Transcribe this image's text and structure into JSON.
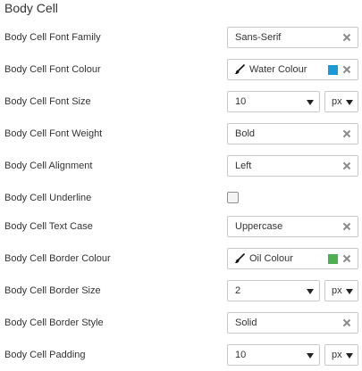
{
  "section": {
    "title": "Body Cell"
  },
  "rows": {
    "font_family": {
      "label": "Body Cell Font Family",
      "value": "Sans-Serif"
    },
    "font_colour": {
      "label": "Body Cell Font Colour",
      "value": "Water Colour",
      "swatch": "#1a9ad6"
    },
    "font_size": {
      "label": "Body Cell Font Size",
      "value": "10",
      "unit": "px"
    },
    "font_weight": {
      "label": "Body Cell Font Weight",
      "value": "Bold"
    },
    "alignment": {
      "label": "Body Cell Alignment",
      "value": "Left"
    },
    "underline": {
      "label": "Body Cell Underline",
      "checked": false
    },
    "text_case": {
      "label": "Body Cell Text Case",
      "value": "Uppercase"
    },
    "border_colour": {
      "label": "Body Cell Border Colour",
      "value": "Oil Colour",
      "swatch": "#4caf50"
    },
    "border_size": {
      "label": "Body Cell Border Size",
      "value": "2",
      "unit": "px"
    },
    "border_style": {
      "label": "Body Cell Border Style",
      "value": "Solid"
    },
    "padding": {
      "label": "Body Cell Padding",
      "value": "10",
      "unit": "px"
    }
  },
  "icons": {
    "clear": "clear-x-icon",
    "brush": "paint-brush-icon",
    "dropdown": "caret-down-icon"
  }
}
